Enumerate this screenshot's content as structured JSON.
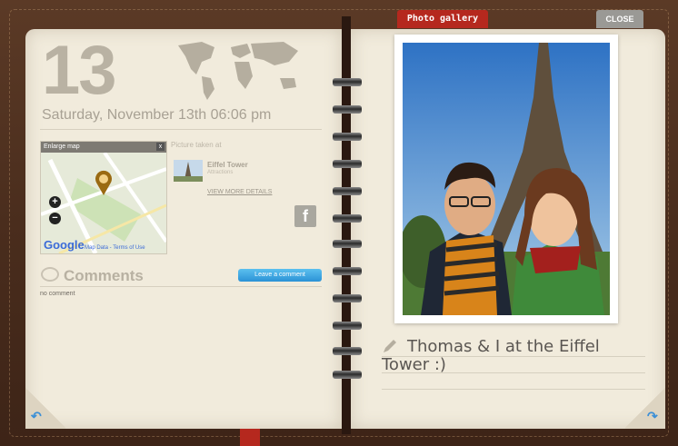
{
  "entry": {
    "day": "13",
    "date_line": "Saturday, November 13th 06:06 pm"
  },
  "map": {
    "header_label": "Enlarge map",
    "close_glyph": "x",
    "zoom_in": "+",
    "zoom_out": "−",
    "provider_logo": "Google",
    "links": "Map Data - Terms of Use"
  },
  "place": {
    "taken_at": "Picture taken at",
    "name": "Eiffel Tower",
    "sub": "Attractions",
    "more_details": "VIEW MORE DETAILS"
  },
  "social": {
    "share_glyph": "f",
    "icon": "facebook-icon"
  },
  "comments": {
    "title": "Comments",
    "empty": "no comment",
    "leave_button": "Leave a comment"
  },
  "gallery": {
    "tab_label": "Photo gallery",
    "close_label": "CLOSE",
    "caption": "Thomas & I at the Eiffel Tower :)"
  },
  "icons": {
    "corner_left": "undo-arrow-icon",
    "corner_right": "redo-arrow-icon",
    "pen": "pencil-icon",
    "comments": "speech-bubble-icon"
  },
  "colors": {
    "accent_red": "#b5281e",
    "button_blue": "#2b92d6",
    "page": "#f1ebdc",
    "leather": "#4a2d1d"
  }
}
